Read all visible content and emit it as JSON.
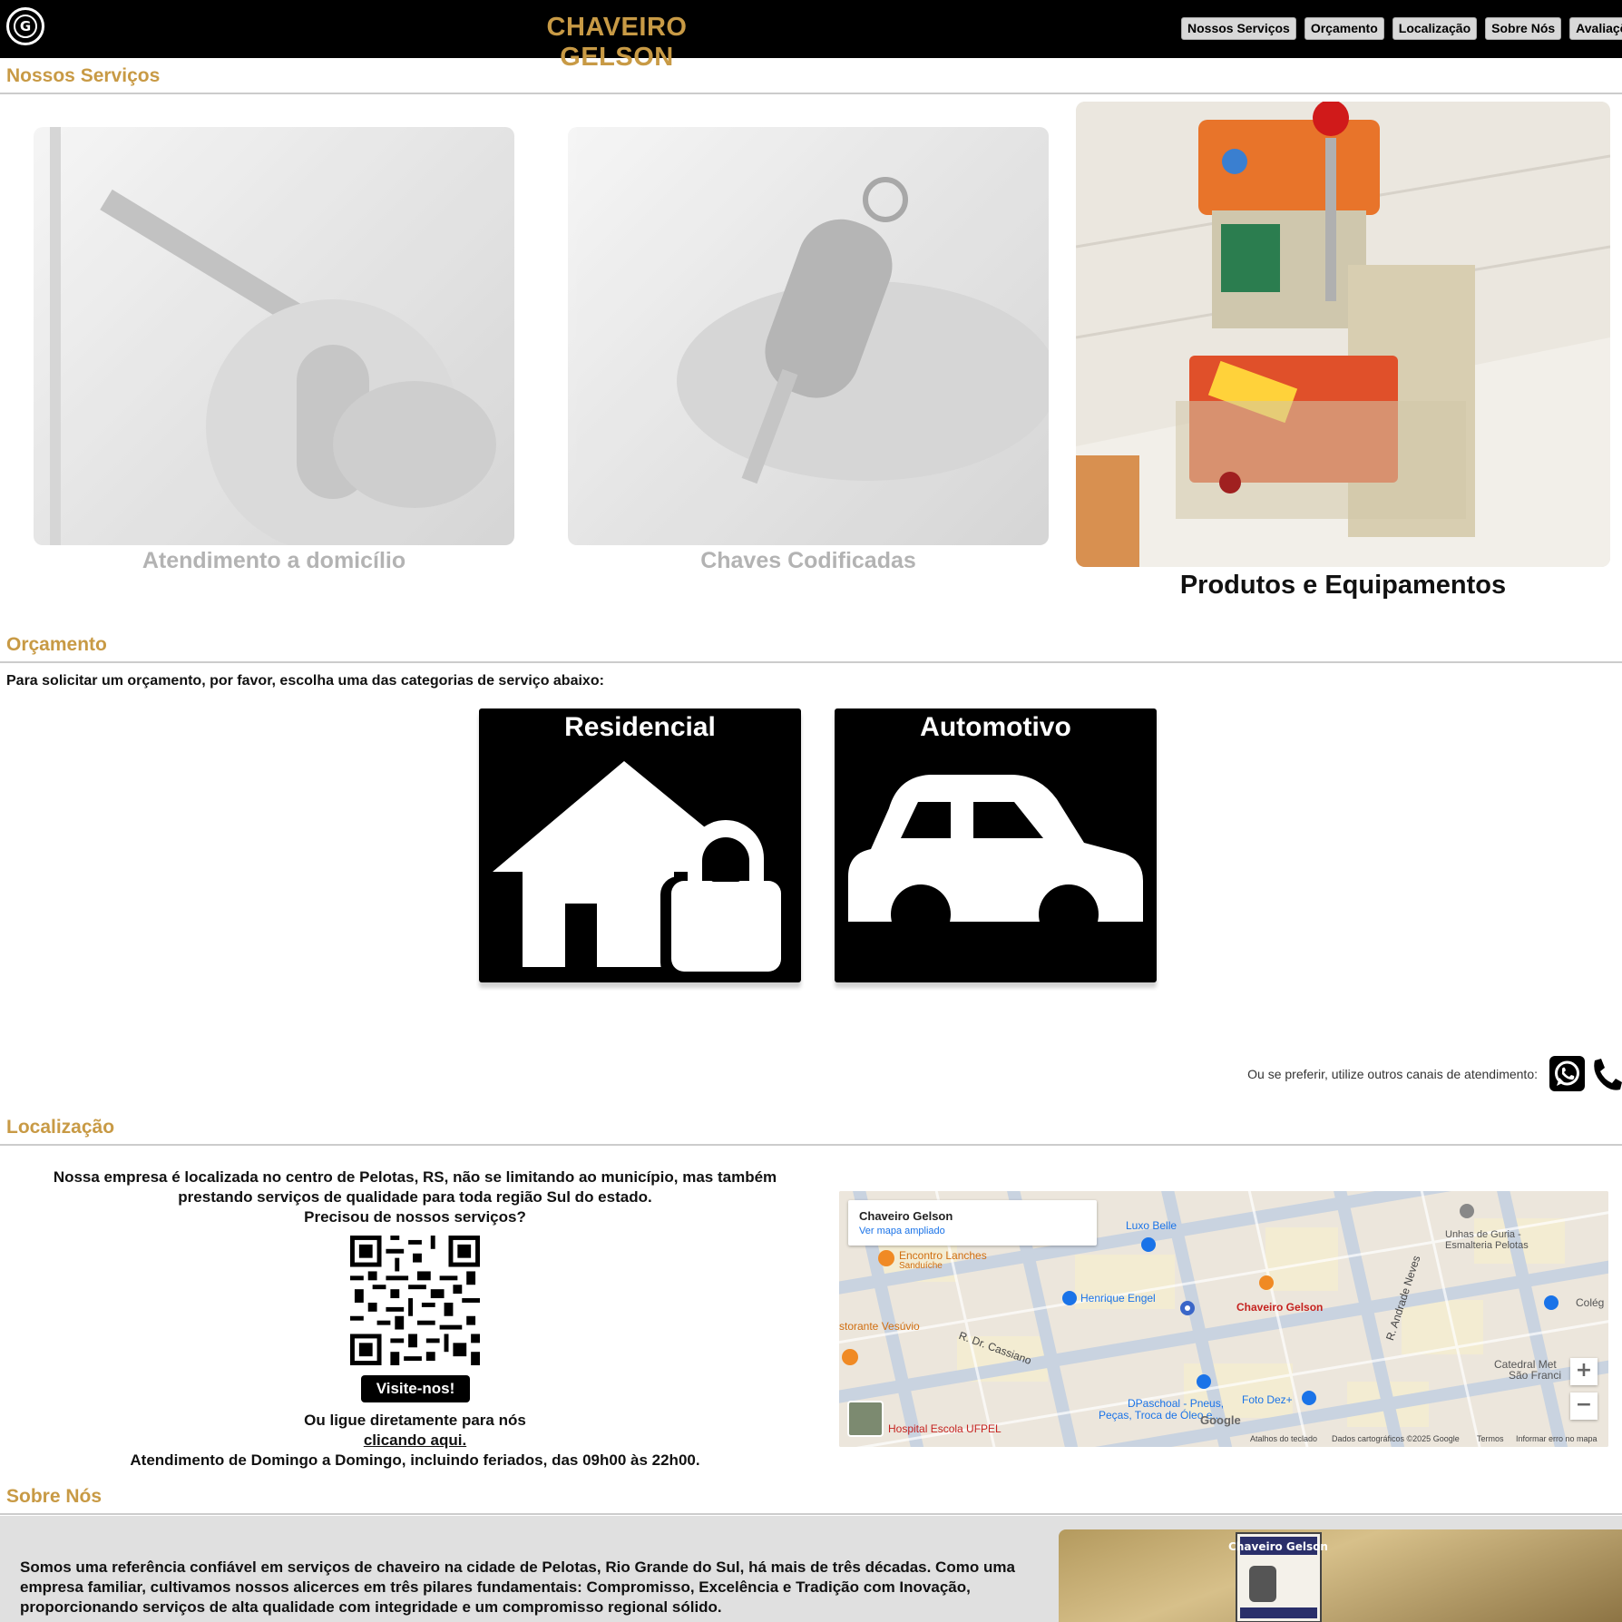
{
  "header": {
    "brand": "CHAVEIRO GELSON",
    "nav": [
      "Nossos Serviços",
      "Orçamento",
      "Localização",
      "Sobre Nós",
      "Avaliações"
    ]
  },
  "colors": {
    "accent": "#c89a45",
    "header_bg": "#000000"
  },
  "servicos": {
    "title": "Nossos Serviços",
    "items": [
      {
        "label": "Atendimento a domicílio",
        "state": "faded"
      },
      {
        "label": "Chaves Codificadas",
        "state": "faded"
      },
      {
        "label": "Produtos e Equipamentos",
        "state": "active"
      }
    ]
  },
  "orcamento": {
    "title": "Orçamento",
    "intro": "Para solicitar um orçamento, por favor, escolha uma das categorias de serviço abaixo:",
    "categories": [
      "Residencial",
      "Automotivo"
    ],
    "alt_channels": "Ou se preferir, utilize outros canais de atendimento:",
    "icons": [
      "whatsapp-icon",
      "phone-icon"
    ]
  },
  "localizacao": {
    "title": "Localização",
    "line1": "Nossa empresa é localizada no centro de Pelotas, RS, não se limitando ao município, mas também",
    "line2": "prestando serviços de qualidade para toda região Sul do estado.",
    "line3": "Precisou de nossos serviços?",
    "visit": "Visite-nos!",
    "call1": "Ou ligue diretamente para nós",
    "call_link": "clicando aqui.",
    "hours": "Atendimento de Domingo a Domingo, incluindo feriados, das 09h00 às 22h00.",
    "map": {
      "place": "Chaveiro Gelson",
      "link": "Ver mapa ampliado",
      "labels": {
        "luxo": "Luxo Belle",
        "unhas": "Unhas de Guria -",
        "unhas2": "Esmalteria Pelotas",
        "encontro": "Encontro Lanches",
        "sanduiche": "Sanduíche",
        "henrique": "Henrique Engel",
        "pin": "Chaveiro Gelson",
        "vesuvio": "storante Vesúvio",
        "cassiano": "R. Dr. Cassiano",
        "neves": "R. Andrade Neves",
        "catedral": "Catedral Met",
        "catedral2": "São Franci",
        "dpaschoal": "DPaschoal - Pneus,",
        "dpaschoal2": "Peças, Troca de Óleo e...",
        "foto": "Foto Dez+",
        "hospital": "Hospital Escola UFPEL",
        "colegio": "Colég"
      },
      "footer": [
        "Atalhos do teclado",
        "Dados cartográficos ©2025 Google",
        "Termos",
        "Informar erro no mapa"
      ],
      "zoom_in": "+",
      "zoom_out": "−",
      "google": "Google"
    }
  },
  "sobre": {
    "title": "Sobre Nós",
    "text": "Somos uma referência confiável em serviços de chaveiro na cidade de Pelotas, Rio Grande do Sul, há mais de três décadas. Como uma empresa familiar, cultivamos nossos alicerces em três pilares fundamentais: Compromisso, Excelência e Tradição com Inovação, proporcionando serviços de alta qualidade com integridade e um compromisso regional sólido.",
    "sign": "Chaveiro Gelson"
  }
}
